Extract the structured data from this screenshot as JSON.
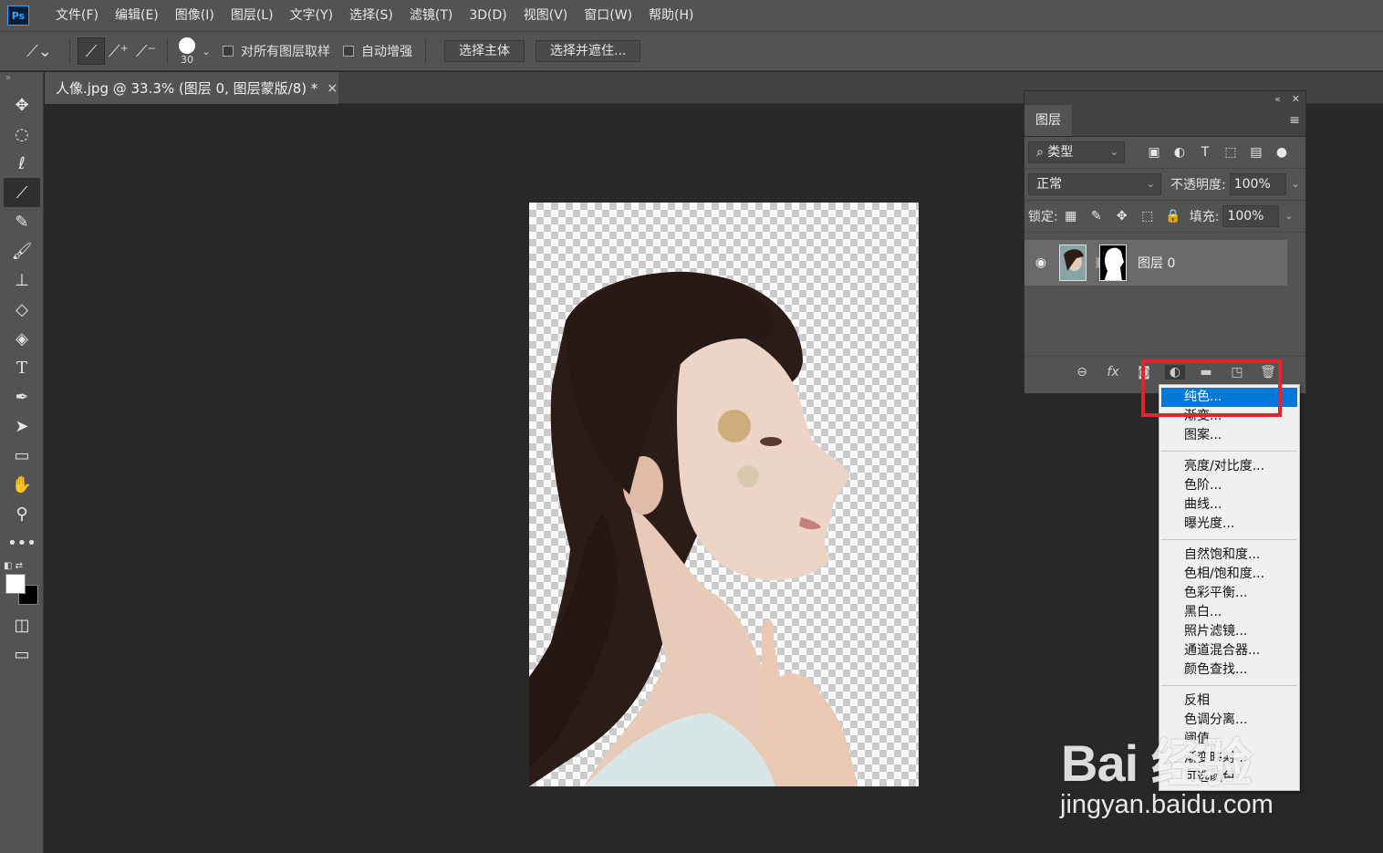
{
  "app": {
    "logo": "Ps"
  },
  "menubar": {
    "items": [
      "文件(F)",
      "编辑(E)",
      "图像(I)",
      "图层(L)",
      "文字(Y)",
      "选择(S)",
      "滤镜(T)",
      "3D(D)",
      "视图(V)",
      "窗口(W)",
      "帮助(H)"
    ]
  },
  "options": {
    "brush_size": "30",
    "sample_all_layers": "对所有图层取样",
    "auto_enhance": "自动增强",
    "select_subject": "选择主体",
    "select_and_mask": "选择并遮住..."
  },
  "document": {
    "tab_title": "人像.jpg @ 33.3% (图层 0, 图层蒙版/8) *",
    "close": "×"
  },
  "layers_panel": {
    "tab": "图层",
    "filter_kind": "类型",
    "blend_mode": "正常",
    "opacity_label": "不透明度:",
    "opacity_value": "100%",
    "lock_label": "锁定:",
    "fill_label": "填充:",
    "fill_value": "100%",
    "layer_name": "图层 0"
  },
  "adjust_menu": {
    "group1": [
      "纯色...",
      "渐变...",
      "图案..."
    ],
    "group2": [
      "亮度/对比度...",
      "色阶...",
      "曲线...",
      "曝光度..."
    ],
    "group3": [
      "自然饱和度...",
      "色相/饱和度...",
      "色彩平衡...",
      "黑白...",
      "照片滤镜...",
      "通道混合器...",
      "颜色查找..."
    ],
    "group4": [
      "反相",
      "色调分离...",
      "阈值...",
      "渐变映射...",
      "可选颜色..."
    ]
  },
  "watermark": {
    "logo": "Bai 经验",
    "url": "jingyan.baidu.com"
  },
  "colors": {
    "highlight": "#0078d7",
    "annotation": "#e3242b"
  }
}
